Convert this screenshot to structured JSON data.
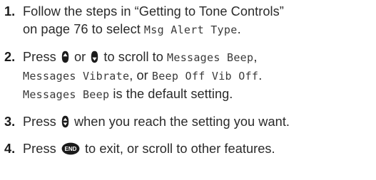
{
  "steps": [
    {
      "number": "1.",
      "text_a": "Follow the steps in “Getting to Tone Controls”",
      "text_b": "on page 76 to select ",
      "lcd_a": "Msg Alert Type",
      "text_c": "."
    },
    {
      "number": "2.",
      "press": "Press ",
      "or": " or ",
      "scroll_to": " to scroll to ",
      "lcd_a": "Messages Beep",
      "comma_a": ",",
      "lcd_b": "Messages Vibrate",
      "comma_or": ", or ",
      "lcd_c": "Beep Off Vib Off",
      "period": ".",
      "lcd_d": "Messages Beep",
      "default_text": " is the default setting."
    },
    {
      "number": "3.",
      "press": "Press ",
      "text": " when you reach the setting you want."
    },
    {
      "number": "4.",
      "press": "Press ",
      "end_key_label": "END",
      "text": " to exit, or scroll to other features."
    }
  ],
  "icons": {
    "scroll_up": "scroll-up-key-icon",
    "scroll_down": "scroll-down-key-icon",
    "select": "select-key-icon",
    "end": "end-key-icon"
  }
}
